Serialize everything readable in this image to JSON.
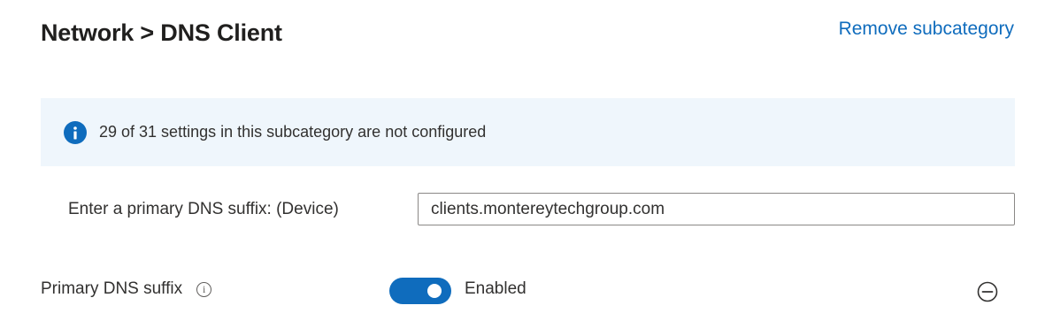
{
  "header": {
    "title": "Network > DNS Client",
    "remove_link": "Remove subcategory"
  },
  "banner": {
    "icon": "info-icon",
    "message": "29 of 31 settings in this subcategory are not configured"
  },
  "primary_dns_suffix_field": {
    "label": "Enter a primary DNS suffix: (Device)",
    "value": "clients.montereytechgroup.com"
  },
  "setting": {
    "label": "Primary DNS suffix",
    "info_icon": "info-circle-icon",
    "toggle_on": true,
    "toggle_state": "Enabled",
    "remove_icon": "minus-circle-icon"
  },
  "colors": {
    "accent": "#0f6cbd",
    "banner_bg": "#eff6fc",
    "text": "#323130"
  }
}
